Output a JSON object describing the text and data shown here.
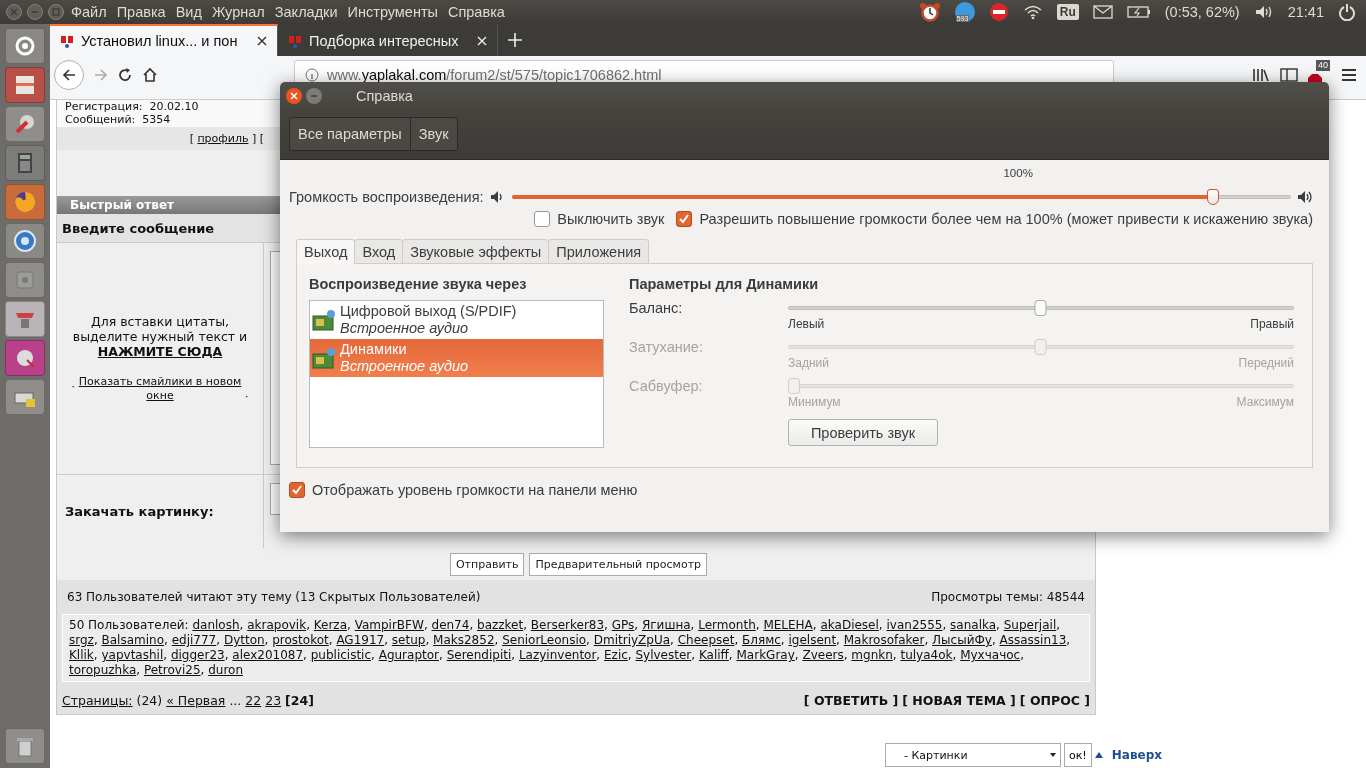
{
  "top_panel": {
    "menu": [
      "Файл",
      "Правка",
      "Вид",
      "Журнал",
      "Закладки",
      "Инструменты",
      "Справка"
    ],
    "mail_count": "593",
    "keyboard_layout": "Ru",
    "battery": "(0:53, 62%)",
    "clock": "21:41"
  },
  "browser": {
    "tabs": [
      {
        "title": "Установил linux... и пон",
        "selected": true
      },
      {
        "title": "Подборка интересных",
        "selected": false
      }
    ],
    "url": "www.**yaplakal.com**/forum2/st/575/topic1706862.html",
    "blocked_count": "40"
  },
  "forum": {
    "profile": {
      "lines": [
        "Регистрация:  20.02.10",
        "Сообщений:  5354"
      ],
      "open": "[",
      "link": "профиль",
      "close": "] ["
    },
    "quick_reply": {
      "title": "Быстрый ответ",
      "message_label": "Введите сообщение",
      "quote_hint": "Для вставки цитаты, выделите нужный текст и",
      "quote_link": "НАЖМИТЕ СЮДА",
      "bullet": "·",
      "smileys_link": "Показать смайлики в новом окне",
      "upload_label": "Закачать картинку:",
      "buttons": [
        "Отправить",
        "Предварительный просмотр"
      ]
    },
    "stats": {
      "readers": "63 Пользователей читают эту тему (13 Скрытых Пользователей)",
      "views": "Просмотры темы: 48544"
    },
    "users": {
      "label": "50 Пользователей:",
      "separator": ", ",
      "names": [
        "danlosh",
        "akrapovik",
        "Kerza",
        "VampirBFW",
        "den74",
        "bazzket",
        "Berserker83",
        "GPs",
        "Ягишна",
        "Lermonth",
        "MELEHA",
        "akaDiesel",
        "ivan2555",
        "sanalka",
        "Superjail",
        "srgz",
        "Balsamino",
        "edji777",
        "Dytton",
        "prostokot",
        "AG1917",
        "setup",
        "Maks2852",
        "SeniorLeonsio",
        "DmitriyZpUa",
        "Cheepset",
        "Блямс",
        "igelsent",
        "Makrosofaker",
        "ЛысыйФу",
        "Assassin13",
        "Kllik",
        "yapvtashil",
        "digger23",
        "alex201087",
        "publicistic",
        "Aguraptor",
        "Serendipiti",
        "Lazyinventor",
        "Ezic",
        "Sylvester",
        "Kaliff",
        "MarkGray",
        "Zveers",
        "mgnkn",
        "tulya4ok",
        "Мухчачос",
        "toropuzhka",
        "Petrovi25",
        "duron"
      ]
    },
    "pagination": {
      "items": [
        {
          "kind": "link",
          "text": "Страницы:"
        },
        {
          "kind": "text",
          "text": "(24)"
        },
        {
          "kind": "link",
          "text": "« Первая"
        },
        {
          "kind": "text",
          "text": "..."
        },
        {
          "kind": "link",
          "text": "22"
        },
        {
          "kind": "link",
          "text": "23"
        },
        {
          "kind": "current",
          "text": "[24]"
        }
      ],
      "actions": [
        "[ ОТВЕТИТЬ ]",
        "[ НОВАЯ ТЕМА ]",
        "[ ОПРОС ]"
      ]
    },
    "footer": {
      "jump_select": "- Картинки",
      "go_button": "ок!",
      "top_link": "Наверх"
    }
  },
  "dialog": {
    "title": "Справка",
    "breadcrumbs": [
      "Все параметры",
      "Звук"
    ],
    "volume": {
      "label": "Громкость воспроизведения:",
      "mark": "100%",
      "level": 0.9
    },
    "options": [
      {
        "label": "Выключить звук",
        "checked": false
      },
      {
        "label": "Разрешить повышение громкости более чем на 100% (может привести к искажению звука)",
        "checked": true
      }
    ],
    "tabs": [
      {
        "label": "Выход",
        "selected": true
      },
      {
        "label": "Вход",
        "selected": false
      },
      {
        "label": "Звуковые эффекты",
        "selected": false
      },
      {
        "label": "Приложения",
        "selected": false
      }
    ],
    "output": {
      "heading": "Воспроизведение звука через",
      "devices": [
        {
          "name": "Цифровой выход (S/PDIF)",
          "detail": "Встроенное аудио",
          "selected": false
        },
        {
          "name": "Динамики",
          "detail": "Встроенное аудио",
          "selected": true
        }
      ]
    },
    "settings": {
      "heading": "Параметры для Динамики",
      "sliders": [
        {
          "label": "Баланс:",
          "level": 0.5,
          "disabled": false,
          "min_label": "Левый",
          "max_label": "Правый"
        },
        {
          "label": "Затухание:",
          "level": 0.5,
          "disabled": true,
          "min_label": "Задний",
          "max_label": "Передний"
        },
        {
          "label": "Сабвуфер:",
          "level": 0,
          "disabled": true,
          "min_label": "Минимум",
          "max_label": "Максимум"
        }
      ],
      "test_button": "Проверить звук"
    },
    "show_in_menu": {
      "label": "Отображать уровень громкости на панели меню",
      "checked": true
    }
  }
}
